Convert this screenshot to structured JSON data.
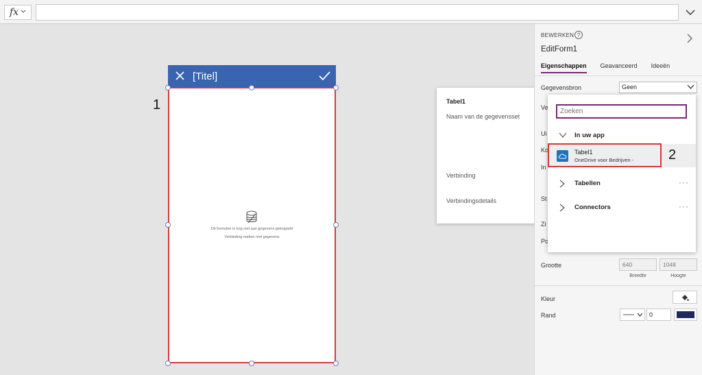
{
  "formula_bar": {
    "fx_label": "fx",
    "value": ""
  },
  "form": {
    "title": "[Titel]",
    "empty_line1": "Dit formulier is nog niet aan gegevens gekoppeld",
    "empty_line2": "Verbinding maken met gegevens"
  },
  "annotations": {
    "one": "1",
    "two": "2"
  },
  "datasource_card": {
    "name": "Tabel1",
    "dataset_label": "Naam van de gegevensset",
    "connection_label": "Verbinding",
    "connection_details_label": "Verbindingsdetails"
  },
  "dropdown": {
    "search_placeholder": "Zoeken",
    "group_in_app": "In uw app",
    "item_name": "Tabel1",
    "item_sub": "OneDrive voor Bedrijven -",
    "group_tables": "Tabellen",
    "group_connectors": "Connectors",
    "more": "···"
  },
  "properties": {
    "section": "BEWERKEN",
    "help": "?",
    "control_name": "EditForm1",
    "tabs": [
      "Eigenschappen",
      "Geavanceerd",
      "Ideeën"
    ],
    "datasource_label": "Gegevensbron",
    "datasource_value": "Geen",
    "partial_labels": [
      "Ve",
      "Ui",
      "Ko",
      "In",
      "St",
      "Zi",
      "Po"
    ],
    "size_label": "Grootte",
    "width_value": "640",
    "height_value": "1048",
    "width_caption": "Breedte",
    "height_caption": "Hoogte",
    "color_label": "Kleur",
    "border_label": "Rand",
    "border_width": "0",
    "border_color": "#1f2a5c"
  },
  "colors": {
    "accent": "#742774",
    "header": "#3a63b1",
    "selection": "#d43a3a"
  }
}
